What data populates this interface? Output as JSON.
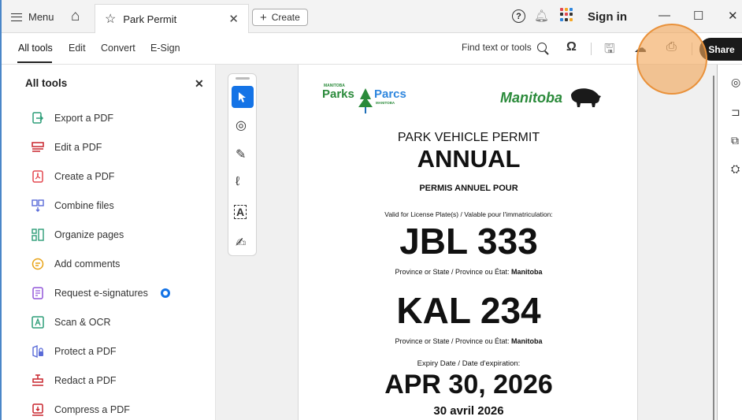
{
  "titlebar": {
    "menu_label": "Menu",
    "tab_title": "Park Permit",
    "create_label": "Create",
    "signin_label": "Sign in"
  },
  "toolbar": {
    "tabs": [
      "All tools",
      "Edit",
      "Convert",
      "E-Sign"
    ],
    "find_label": "Find text or tools",
    "share_label": "Share"
  },
  "left_panel": {
    "title": "All tools",
    "tools": [
      {
        "label": "Export a PDF",
        "icon": "export-pdf-icon",
        "color": "#2d9d78"
      },
      {
        "label": "Edit a PDF",
        "icon": "edit-pdf-icon",
        "color": "#c9252d"
      },
      {
        "label": "Create a PDF",
        "icon": "create-pdf-icon",
        "color": "#e34850"
      },
      {
        "label": "Combine files",
        "icon": "combine-files-icon",
        "color": "#5a6bd8"
      },
      {
        "label": "Organize pages",
        "icon": "organize-pages-icon",
        "color": "#2d9d78"
      },
      {
        "label": "Add comments",
        "icon": "add-comments-icon",
        "color": "#e8a317"
      },
      {
        "label": "Request e-signatures",
        "icon": "request-esignature-icon",
        "color": "#9256d9"
      },
      {
        "label": "Scan & OCR",
        "icon": "scan-ocr-icon",
        "color": "#2d9d78"
      },
      {
        "label": "Protect a PDF",
        "icon": "protect-pdf-icon",
        "color": "#5a6bd8"
      },
      {
        "label": "Redact a PDF",
        "icon": "redact-pdf-icon",
        "color": "#c9252d"
      },
      {
        "label": "Compress a PDF",
        "icon": "compress-pdf-icon",
        "color": "#c9252d"
      }
    ]
  },
  "document": {
    "logo_left_small": "MANITOBA",
    "logo_left_parks": "Parks",
    "logo_left_parcs": "Parcs",
    "logo_left_small2": "MANITOBA",
    "logo_right": "Manitoba",
    "permit_title": "PARK VEHICLE PERMIT",
    "permit_type": "ANNUAL",
    "permit_type_fr": "PERMIS ANNUEL POUR",
    "valid_for": "Valid for License Plate(s) / Valable pour l'immatriculation:",
    "plate1": "JBL 333",
    "province_label": "Province or State / Province ou État:",
    "province_value": "Manitoba",
    "plate2": "KAL 234",
    "expiry_label": "Expiry Date / Date d'expiration:",
    "expiry_en": "APR 30, 2026",
    "expiry_fr": "30 avril 2026"
  },
  "colors": {
    "accent_blue": "#1473e6",
    "highlight": "#f2a658",
    "manitoba_green": "#2a8a3a"
  }
}
